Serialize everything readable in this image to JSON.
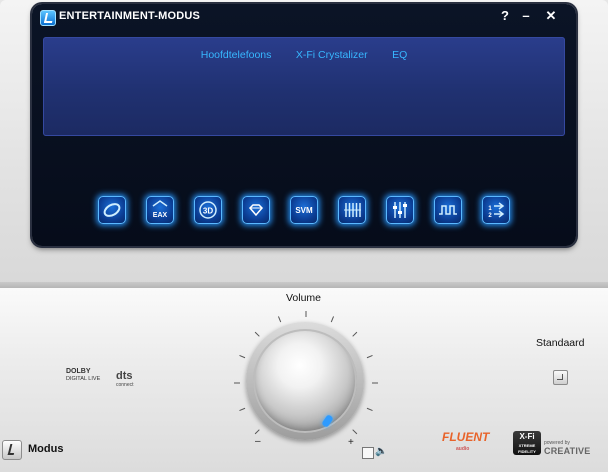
{
  "window": {
    "title": "ENTERTAINMENT-MODUS",
    "help_label": "?",
    "minimize_label": "–",
    "close_label": "✕"
  },
  "panel": {
    "tabs": [
      "Hoofdtelefoons",
      "X-Fi Crystalizer",
      "EQ"
    ]
  },
  "effect_buttons": [
    {
      "name": "ring-icon"
    },
    {
      "name": "eax-icon",
      "label": "EAX"
    },
    {
      "name": "3d-icon",
      "label": "3D"
    },
    {
      "name": "diamond-icon"
    },
    {
      "name": "svm-icon",
      "label": "SVM"
    },
    {
      "name": "bars-icon"
    },
    {
      "name": "mixer-icon"
    },
    {
      "name": "wave-icon"
    },
    {
      "name": "route-icon",
      "label": "1 2"
    }
  ],
  "controls": {
    "volume_label": "Volume",
    "volume_min": "–",
    "volume_max": "+",
    "standard_label": "Standaard",
    "mode_label": "Modus"
  },
  "logos": {
    "dolby_main": "DOLBY",
    "dolby_sub": "DIGITAL LIVE",
    "dts_main": "dts",
    "dts_sub": "connect",
    "fluent_main": "FLUENT",
    "fluent_sub": "audio",
    "xfi_main": "X-Fi",
    "xfi_sub": "XTREME FIDELITY",
    "creative_small": "powered by",
    "creative_main": "CREATIVE"
  },
  "colors": {
    "accent_blue": "#37b7ff",
    "display_bg": "#0b1426",
    "panel_bg": "#2a3d8c"
  }
}
